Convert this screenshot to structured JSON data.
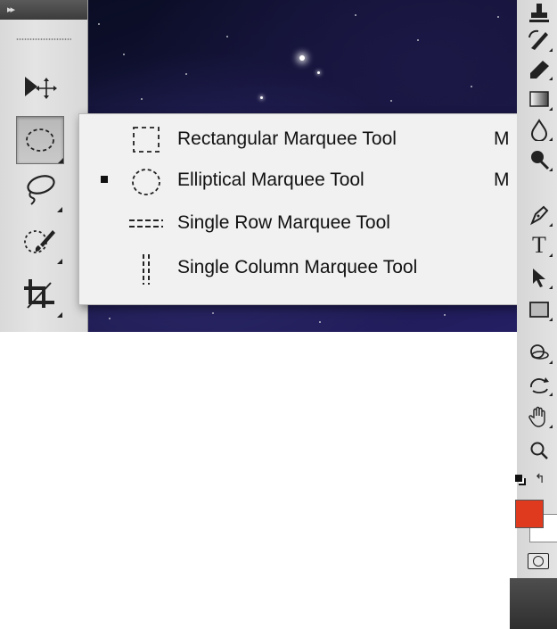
{
  "toolbox": {
    "header_glyph": "▸▸",
    "tools": [
      {
        "name": "move-tool",
        "icon": "move-icon"
      },
      {
        "name": "elliptical-marquee-tool",
        "icon": "elliptical-marquee-icon",
        "selected": true
      },
      {
        "name": "lasso-tool",
        "icon": "lasso-icon"
      },
      {
        "name": "quick-selection-tool",
        "icon": "quick-selection-icon"
      },
      {
        "name": "crop-tool",
        "icon": "crop-icon"
      }
    ]
  },
  "flyout": {
    "items": [
      {
        "label": "Rectangular Marquee Tool",
        "shortcut": "M",
        "icon": "rectangular-marquee-icon",
        "active": false
      },
      {
        "label": "Elliptical Marquee Tool",
        "shortcut": "M",
        "icon": "elliptical-marquee-icon",
        "active": true
      },
      {
        "label": "Single Row Marquee Tool",
        "shortcut": "",
        "icon": "single-row-marquee-icon",
        "active": false
      },
      {
        "label": "Single Column Marquee Tool",
        "shortcut": "",
        "icon": "single-column-marquee-icon",
        "active": false
      }
    ]
  },
  "right_tools": {
    "type_glyph": "T",
    "swap_glyph": "↰",
    "icons": [
      "clone-stamp-icon",
      "history-brush-icon",
      "eraser-icon",
      "gradient-icon",
      "blur-icon",
      "dodge-icon",
      "pen-icon",
      "type-icon",
      "path-selection-icon",
      "shape-icon",
      "3d-rotate-icon",
      "3d-orbit-icon",
      "hand-icon",
      "zoom-icon"
    ]
  },
  "colors": {
    "foreground": "#e03a1e",
    "background": "#ffffff",
    "canvas_accent": "#241f63"
  }
}
